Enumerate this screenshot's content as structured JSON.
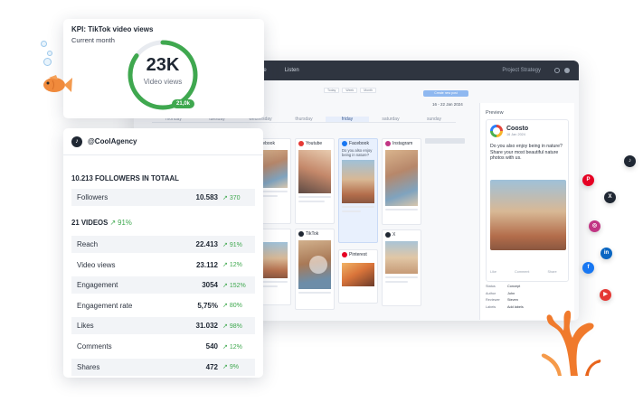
{
  "kpi_card": {
    "title": "KPI: TikTok video views",
    "period": "Current month",
    "value": "23K",
    "label": "Video views",
    "target_badge": "21,0k",
    "progress_fraction": 0.85,
    "accent_color": "#3fa84f"
  },
  "account_card": {
    "handle": "@CoolAgency",
    "followers_section": "10.213 FOLLOWERS IN TOTAAL",
    "followers_row": {
      "label": "Followers",
      "value": "10.583",
      "change": "370"
    },
    "videos_section": "21 VIDEOS",
    "videos_change": "↗ 91%",
    "rows": [
      {
        "label": "Reach",
        "value": "22.413",
        "change": "91%"
      },
      {
        "label": "Video views",
        "value": "23.112",
        "change": "12%"
      },
      {
        "label": "Engagement",
        "value": "3054",
        "change": "152%"
      },
      {
        "label": "Engagement rate",
        "value": "5,75%",
        "change": "80%"
      },
      {
        "label": "Likes",
        "value": "31.032",
        "change": "98%"
      },
      {
        "label": "Comments",
        "value": "540",
        "change": "12%"
      },
      {
        "label": "Shares",
        "value": "472",
        "change": "9%"
      }
    ]
  },
  "app": {
    "nav": [
      "ge",
      "Listen"
    ],
    "project": "Project Strategy",
    "toolbar": [
      "Today",
      "Week",
      "Month"
    ],
    "schedule_button": "Create new post",
    "date_range": "16 - 22 Jan 2024",
    "days": [
      "monday",
      "tuesday",
      "wednesday",
      "thursday",
      "friday",
      "saturday",
      "sunday"
    ],
    "active_day": "friday",
    "columns": {
      "c1": {
        "network": "Facebook"
      },
      "c2": {
        "network": "Youtube",
        "network2": "TikTok"
      },
      "c3": {
        "network": "Facebook",
        "text": "Do you also enjoy being in nature?",
        "network2": "Pinterest"
      },
      "c4": {
        "network": "Instagram",
        "network2": "X"
      }
    }
  },
  "preview": {
    "title": "Preview",
    "brand": "Coosto",
    "date": "16 Jan 2024",
    "text": "Do you also enjoy being in nature? Share your most beautiful nature photos with us.",
    "actions": [
      "Like",
      "Comment",
      "Share"
    ],
    "meta": [
      {
        "k": "Status",
        "v": "Concept"
      },
      {
        "k": "Author",
        "v": "John"
      },
      {
        "k": "Reviewer",
        "v": "Steven"
      },
      {
        "k": "Labels",
        "v": "Add labels"
      }
    ]
  },
  "social_icons": [
    "tiktok-icon",
    "pinterest-icon",
    "x-icon",
    "instagram-icon",
    "linkedin-icon",
    "facebook-icon",
    "youtube-icon"
  ]
}
